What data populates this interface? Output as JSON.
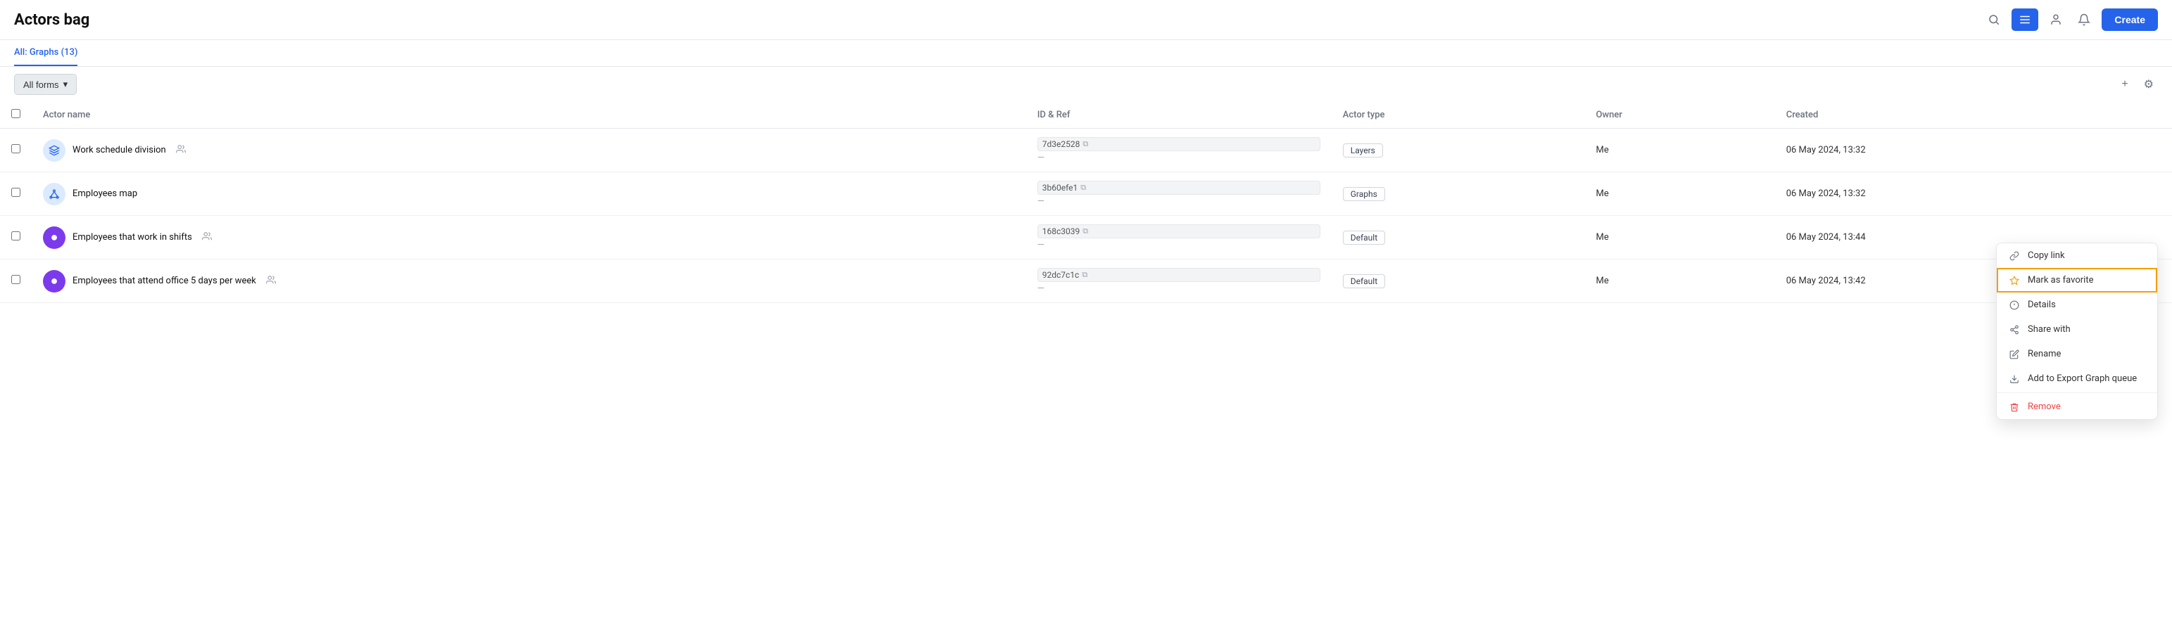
{
  "header": {
    "title": "Actors bag",
    "create_label": "Create"
  },
  "tabs": [
    {
      "label": "All: Graphs (13)",
      "active": true
    }
  ],
  "toolbar": {
    "filter_label": "All forms",
    "plus_label": "+",
    "settings_label": "⚙"
  },
  "table": {
    "columns": [
      "Actor name",
      "ID & Ref",
      "Actor type",
      "Owner",
      "Created"
    ],
    "rows": [
      {
        "id": 1,
        "name": "Work schedule division",
        "shared": true,
        "icon_type": "layers",
        "id_ref": "7d3e2528",
        "actor_type": "Layers",
        "owner": "Me",
        "created": "06 May 2024, 13:32"
      },
      {
        "id": 2,
        "name": "Employees map",
        "shared": false,
        "icon_type": "graph",
        "id_ref": "3b60efe1",
        "actor_type": "Graphs",
        "owner": "Me",
        "created": "06 May 2024, 13:32"
      },
      {
        "id": 3,
        "name": "Employees that work in shifts",
        "shared": true,
        "icon_type": "purple",
        "id_ref": "168c3039",
        "actor_type": "Default",
        "owner": "Me",
        "created": "06 May 2024, 13:44"
      },
      {
        "id": 4,
        "name": "Employees that attend office 5 days per week",
        "shared": true,
        "icon_type": "purple",
        "id_ref": "92dc7c1c",
        "actor_type": "Default",
        "owner": "Me",
        "created": "06 May 2024, 13:42"
      }
    ]
  },
  "context_menu": {
    "items": [
      {
        "id": "copy-link",
        "icon": "🔗",
        "label": "Copy link"
      },
      {
        "id": "mark-favorite",
        "icon": "☆",
        "label": "Mark as favorite",
        "active": true
      },
      {
        "id": "details",
        "icon": "ℹ",
        "label": "Details"
      },
      {
        "id": "share-with",
        "icon": "↗",
        "label": "Share with"
      },
      {
        "id": "rename",
        "icon": "✏",
        "label": "Rename"
      },
      {
        "id": "add-export",
        "icon": "⬇",
        "label": "Add to Export Graph queue"
      },
      {
        "id": "remove",
        "icon": "🗑",
        "label": "Remove",
        "danger": true
      }
    ]
  }
}
